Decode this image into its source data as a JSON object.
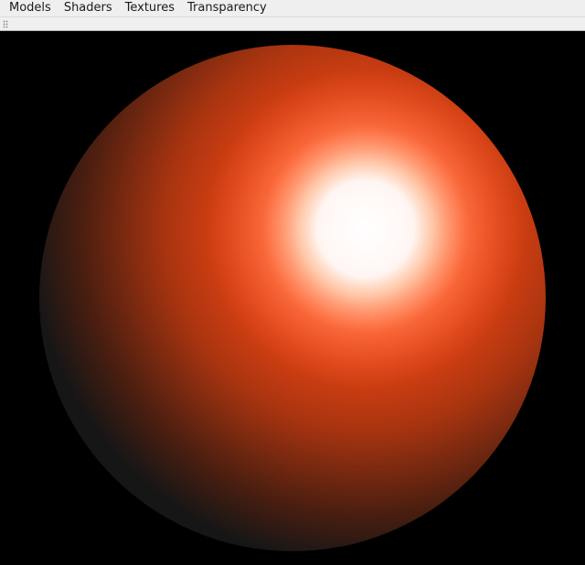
{
  "menubar": {
    "items": [
      {
        "label": "Models"
      },
      {
        "label": "Shaders"
      },
      {
        "label": "Textures"
      },
      {
        "label": "Transparency"
      }
    ]
  },
  "scene": {
    "background_color": "#000000",
    "object": "sphere",
    "base_color": "#ff4a14",
    "ambient_color": "#161616",
    "specular_color": "#ffffff"
  }
}
